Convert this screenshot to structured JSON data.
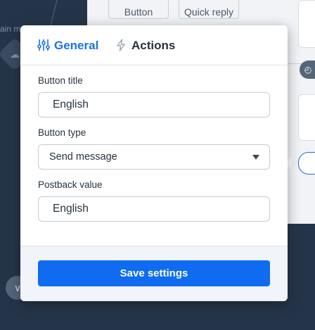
{
  "background": {
    "canvas_label": "ain m",
    "tabs": [
      "Button",
      "Quick reply"
    ]
  },
  "modal": {
    "tabs": [
      {
        "label": "General",
        "icon": "sliders-icon",
        "active": true,
        "color": "#1a73e8"
      },
      {
        "label": "Actions",
        "icon": "lightning-icon",
        "active": false
      }
    ],
    "fields": {
      "button_title": {
        "label": "Button title",
        "value": "English"
      },
      "button_type": {
        "label": "Button type",
        "value": "Send message"
      },
      "postback_value": {
        "label": "Postback value",
        "value": "English"
      }
    },
    "save_button": {
      "label": "Save settings",
      "color": "#0f6cf0"
    }
  }
}
